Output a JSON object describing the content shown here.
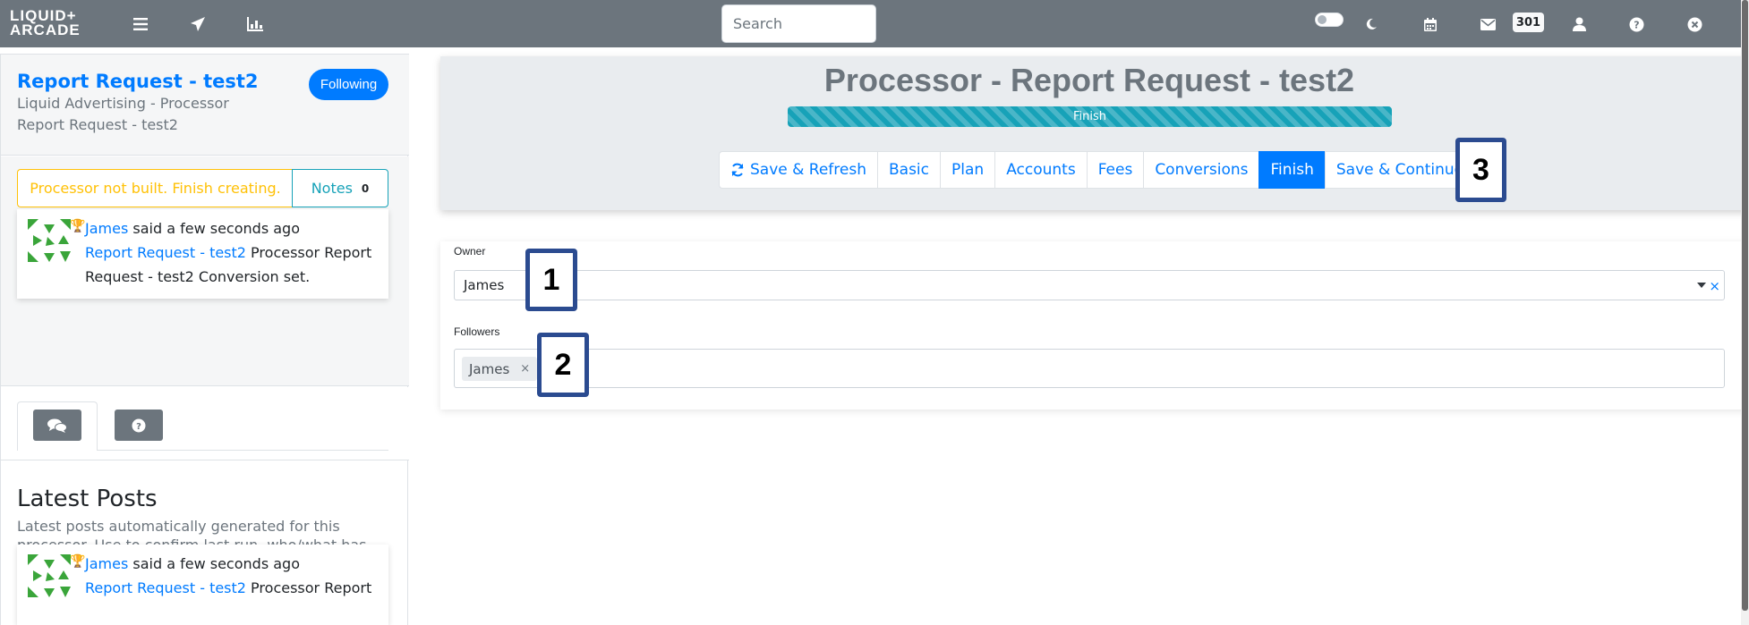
{
  "brand": {
    "line1": "LIQUID+",
    "line2": "ARCADE"
  },
  "navbar": {
    "search_placeholder": "Search",
    "message_count": "301"
  },
  "sidebar": {
    "title": "Report Request - test2",
    "subtitle": "Liquid Advertising - Processor Report Request - test2",
    "following_label": "Following",
    "warning_text": "Processor not built. Finish creating.",
    "notes_label": "Notes",
    "notes_count": "0",
    "post1": {
      "author": "James",
      "said": " said a few seconds ago",
      "link": "Report Request - test2",
      "rest": " Processor Report Request - test2 Conversion set."
    },
    "latest_title": "Latest Posts",
    "latest_desc": "Latest posts automatically generated for this processor. Use to confirm last run, who/what has been changed and when etc.",
    "post2": {
      "author": "James",
      "said": " said a few seconds ago",
      "link": "Report Request - test2",
      "rest": " Processor Report"
    }
  },
  "header": {
    "title": "Processor - Report Request - test2",
    "progress_label": "Finish",
    "progress_percent": 100,
    "buttons": {
      "save_refresh": "Save & Refresh",
      "basic": "Basic",
      "plan": "Plan",
      "accounts": "Accounts",
      "fees": "Fees",
      "conversions": "Conversions",
      "finish": "Finish",
      "save_continue": "Save & Continue"
    }
  },
  "form": {
    "owner_label": "Owner",
    "owner_value": "James",
    "owner_clear": "×",
    "followers_label": "Followers",
    "followers": [
      {
        "name": "James",
        "remove": "×"
      }
    ]
  },
  "markers": {
    "m1": "1",
    "m2": "2",
    "m3": "3"
  },
  "colors": {
    "navbar": "#6c757d",
    "primary": "#007bff",
    "warning": "#ffc107",
    "info": "#17a2b8",
    "marker": "#2b4b90"
  }
}
